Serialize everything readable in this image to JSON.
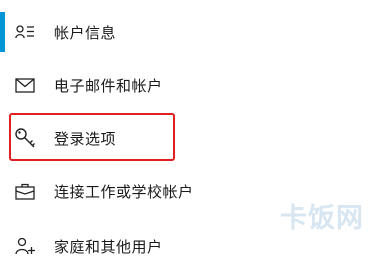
{
  "colors": {
    "accent": "#0096d6",
    "highlight": "#e02020",
    "watermark": "#8fb8d8",
    "icon": "#222222"
  },
  "nav": {
    "items": [
      {
        "label": "帐户信息",
        "icon": "account-info-icon",
        "selected": true
      },
      {
        "label": "电子邮件和帐户",
        "icon": "mail-icon",
        "selected": false
      },
      {
        "label": "登录选项",
        "icon": "key-icon",
        "selected": false,
        "highlighted": true
      },
      {
        "label": "连接工作或学校帐户",
        "icon": "briefcase-icon",
        "selected": false
      },
      {
        "label": "家庭和其他用户",
        "icon": "add-person-icon",
        "selected": false
      }
    ]
  },
  "watermark": {
    "text": "卡饭网"
  }
}
